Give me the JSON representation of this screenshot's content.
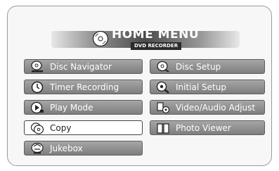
{
  "menu": {
    "title": "HOME MENU",
    "subtitle": "DVD RECORDER",
    "left_items": [
      {
        "label": "Disc Navigator",
        "icon": "disc-navigator-icon"
      },
      {
        "label": "Timer Recording",
        "icon": "clock-icon"
      },
      {
        "label": "Play Mode",
        "icon": "play-mode-icon"
      },
      {
        "label": "Copy",
        "icon": "copy-icon",
        "selected": true
      },
      {
        "label": "Jukebox",
        "icon": "jukebox-icon"
      }
    ],
    "right_items": [
      {
        "label": "Disc Setup",
        "icon": "disc-setup-icon"
      },
      {
        "label": "Initial Setup",
        "icon": "initial-setup-icon"
      },
      {
        "label": "Video/Audio Adjust",
        "icon": "video-audio-adjust-icon"
      },
      {
        "label": "Photo Viewer",
        "icon": "photo-viewer-icon"
      }
    ]
  }
}
